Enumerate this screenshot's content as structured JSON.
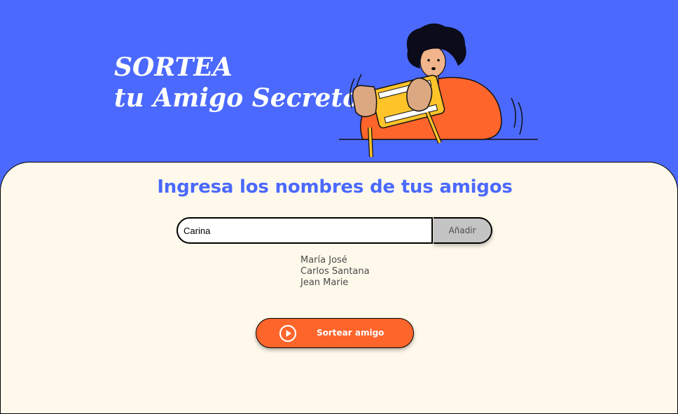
{
  "header": {
    "title_line1": "SORTEA",
    "title_line2": "tu Amigo Secreto",
    "illustration_icon": "person-playing-handheld-console-illustration"
  },
  "main": {
    "heading": "Ingresa los nombres de tus amigos",
    "input": {
      "value": "Carina",
      "placeholder": ""
    },
    "add_button_label": "Añadir",
    "friends": [
      "María José",
      "Carlos Santana",
      "Jean Marie"
    ],
    "draw_button_label": "Sortear amigo",
    "draw_button_icon": "play-circle-icon"
  },
  "colors": {
    "primary_blue": "#4b69fd",
    "accent_orange": "#fe652b",
    "content_bg": "#fff9eb",
    "button_grey": "#c4c4c4"
  }
}
